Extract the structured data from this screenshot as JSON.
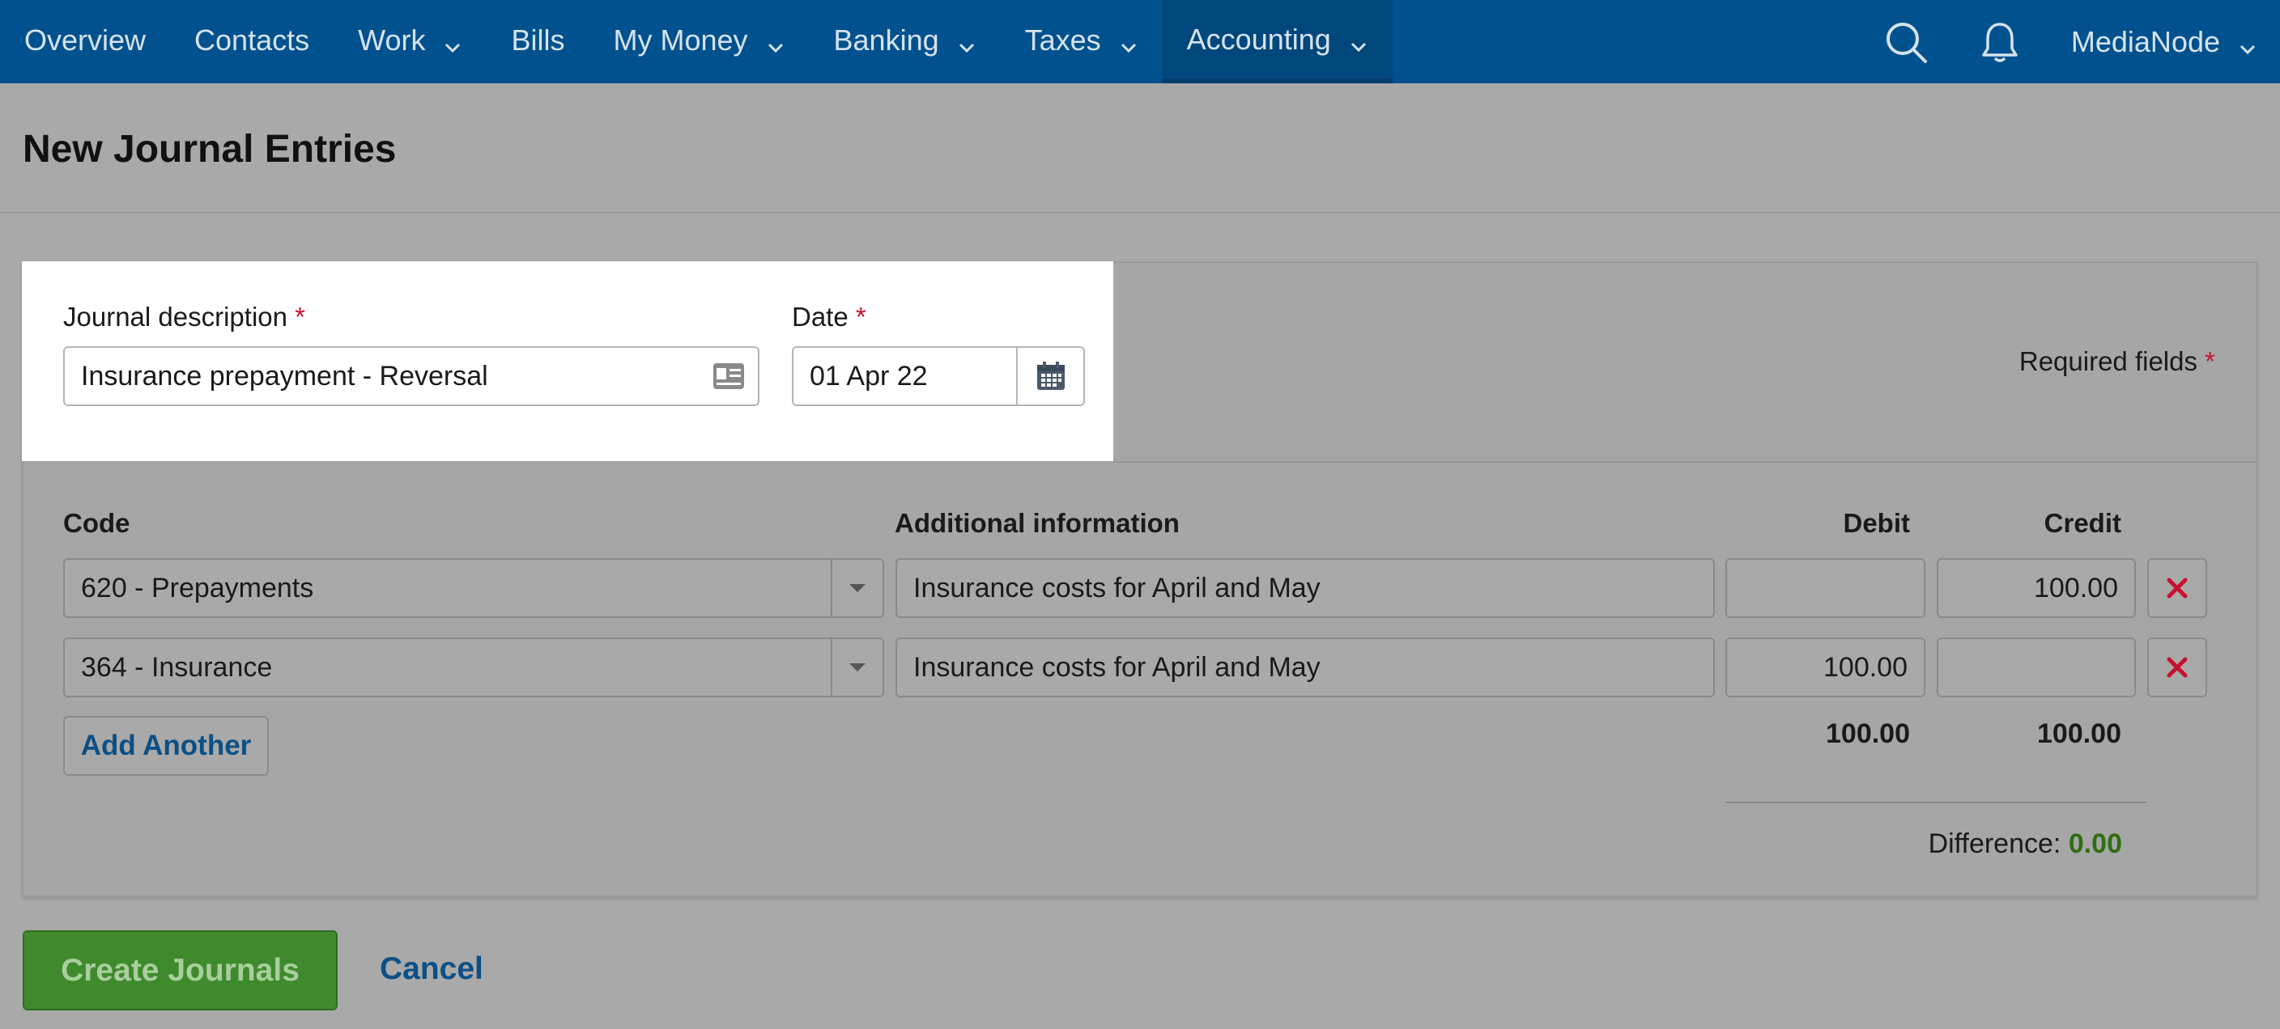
{
  "nav": {
    "items": [
      {
        "label": "Overview",
        "dropdown": false
      },
      {
        "label": "Contacts",
        "dropdown": false
      },
      {
        "label": "Work",
        "dropdown": true
      },
      {
        "label": "Bills",
        "dropdown": false
      },
      {
        "label": "My Money",
        "dropdown": true
      },
      {
        "label": "Banking",
        "dropdown": true
      },
      {
        "label": "Taxes",
        "dropdown": true
      },
      {
        "label": "Accounting",
        "dropdown": true,
        "active": true
      }
    ],
    "account_label": "MediaNode",
    "icons": [
      "search-icon",
      "bell-icon",
      "chevron-down-icon"
    ]
  },
  "page": {
    "title": "New Journal Entries"
  },
  "form": {
    "description_label": "Journal description",
    "description_value": "Insurance prepayment - Reversal",
    "date_label": "Date",
    "date_value": "01 Apr 22",
    "required_star": "*",
    "required_note": "Required fields"
  },
  "table": {
    "headers": {
      "code": "Code",
      "info": "Additional information",
      "debit": "Debit",
      "credit": "Credit"
    },
    "rows": [
      {
        "code": "620 - Prepayments",
        "info": "Insurance costs for April and May",
        "debit": "",
        "credit": "100.00"
      },
      {
        "code": "364 - Insurance",
        "info": "Insurance costs for April and May",
        "debit": "100.00",
        "credit": ""
      }
    ],
    "add_label": "Add Another",
    "total_debit": "100.00",
    "total_credit": "100.00",
    "difference_label": "Difference:",
    "difference_value": "0.00"
  },
  "actions": {
    "create_label": "Create Journals",
    "cancel_label": "Cancel"
  },
  "colors": {
    "nav_bg": "#00518d",
    "primary_button": "#3f8a2d",
    "link": "#0b4f85",
    "required": "#c8102e",
    "delete": "#c8102e",
    "difference_ok": "#2e6e12"
  }
}
